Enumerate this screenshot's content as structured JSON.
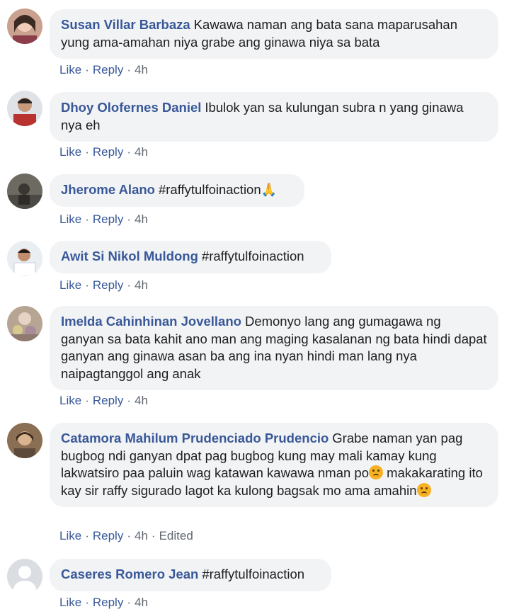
{
  "comments": [
    {
      "author": "Susan Villar Barbaza",
      "text": "Kawawa naman ang bata sana maparusahan yung ama-amahan niya grabe ang ginawa niya sa bata",
      "like": "Like",
      "reply": "Reply",
      "time": "4h"
    },
    {
      "author": "Dhoy Olofernes Daniel",
      "text": "Ibulok yan sa kulungan subra n yang ginawa nya eh",
      "like": "Like",
      "reply": "Reply",
      "time": "4h"
    },
    {
      "author": "Jherome Alano",
      "text": "#raffytulfoinaction",
      "emoji": "pray-emoji",
      "like": "Like",
      "reply": "Reply",
      "time": "4h"
    },
    {
      "author": "Awit Si Nikol Muldong",
      "text": "#raffytulfoinaction",
      "like": "Like",
      "reply": "Reply",
      "time": "4h"
    },
    {
      "author": "Imelda Cahinhinan Jovellano",
      "text": "Demonyo lang ang gumagawa ng ganyan sa bata kahit ano man ang maging kasalanan ng bata hindi dapat ganyan ang ginawa asan ba ang ina nyan hindi man lang nya naipagtanggol ang anak",
      "like": "Like",
      "reply": "Reply",
      "time": "4h"
    },
    {
      "author": "Catamora Mahilum Prudenciado Prudencio",
      "text_a": "Grabe naman yan pag bugbog ndi ganyan dpat pag bugbog kung may mali kamay kung lakwatsiro paa paluin wag katawan kawawa nman po",
      "text_b": "makakarating ito kay sir raffy sigurado lagot ka kulong bagsak mo ama amahin",
      "emoji": "sad-face-emoji",
      "like": "Like",
      "reply": "Reply",
      "time": "4h",
      "edited": "Edited"
    },
    {
      "author": "Caseres Romero Jean",
      "text": "#raffytulfoinaction",
      "like": "Like",
      "reply": "Reply",
      "time": "4h"
    }
  ],
  "colors": {
    "author": "#385898",
    "bubble": "#f2f3f5",
    "meta": "#606770"
  }
}
